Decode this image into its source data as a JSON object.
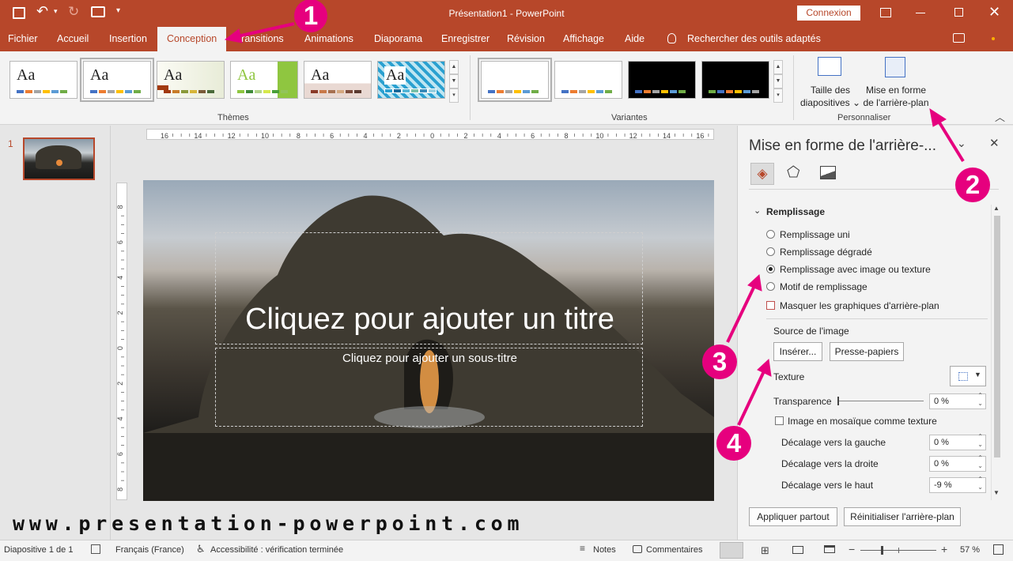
{
  "window": {
    "title": "Présentation1 - PowerPoint",
    "connexion": "Connexion"
  },
  "tabs": [
    "Fichier",
    "Accueil",
    "Insertion",
    "Conception",
    "Transitions",
    "Animations",
    "Diaporama",
    "Enregistrer",
    "Révision",
    "Affichage",
    "Aide"
  ],
  "active_tab": "Conception",
  "search": {
    "label": "Rechercher des outils adaptés"
  },
  "ribbon": {
    "themes_label": "Thèmes",
    "variants_label": "Variantes",
    "customize_label": "Personnaliser",
    "theme_sample": "Aa",
    "slide_size_line1": "Taille des",
    "slide_size_line2": "diapositives ⌄",
    "bg_format_line1": "Mise en forme",
    "bg_format_line2": "de l'arrière-plan"
  },
  "slide_panel": {
    "number": "1"
  },
  "slide": {
    "title_placeholder": "Cliquez pour ajouter un titre",
    "subtitle_placeholder": "Cliquez pour ajouter un sous-titre"
  },
  "ruler": {
    "h_labels": [
      "16",
      "14",
      "12",
      "10",
      "8",
      "6",
      "4",
      "2",
      "0",
      "2",
      "4",
      "6",
      "8",
      "10",
      "12",
      "14",
      "16"
    ],
    "v_labels": [
      "8",
      "6",
      "4",
      "2",
      "0",
      "2",
      "4",
      "6",
      "8"
    ]
  },
  "pane": {
    "title": "Mise en forme de l'arrière-...",
    "section": "Remplissage",
    "options": [
      "Remplissage uni",
      "Remplissage dégradé",
      "Remplissage avec image ou texture",
      "Motif de remplissage"
    ],
    "selected_option": "Remplissage avec image ou texture",
    "hide_bg": "Masquer les graphiques d'arrière-plan",
    "source_label": "Source de l'image",
    "insert_btn": "Insérer...",
    "clipboard_btn": "Presse-papiers",
    "texture_label": "Texture",
    "transparency_label": "Transparence",
    "transparency_value": "0 %",
    "tile_label": "Image en mosaïque comme texture",
    "offset_left_label": "Décalage vers la gauche",
    "offset_left_value": "0 %",
    "offset_right_label": "Décalage vers la droite",
    "offset_right_value": "0 %",
    "offset_top_label": "Décalage vers le haut",
    "offset_top_value": "-9 %",
    "apply_all": "Appliquer partout",
    "reset_bg": "Réinitialiser l'arrière-plan"
  },
  "watermark": "www.presentation-powerpoint.com",
  "annotations": [
    "1",
    "2",
    "3",
    "4"
  ],
  "status": {
    "slide_info": "Diapositive 1 de 1",
    "language": "Français (France)",
    "accessibility": "Accessibilité : vérification terminée",
    "notes": "Notes",
    "comments": "Commentaires",
    "zoom": "57 %"
  },
  "colors": {
    "accent": "#b7472a",
    "annotation": "#e6007e"
  }
}
